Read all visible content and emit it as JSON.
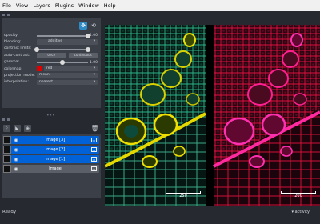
{
  "menu": [
    "File",
    "View",
    "Layers",
    "Plugins",
    "Window",
    "Help"
  ],
  "controls": {
    "rows": [
      {
        "label": "opacity:",
        "kind": "slider",
        "value": "1.00",
        "level": 1.0
      },
      {
        "label": "blending:",
        "kind": "combo",
        "value": "additive"
      },
      {
        "label": "contrast limits:",
        "kind": "range",
        "level_lo": 0.0,
        "level_hi": 1.0
      },
      {
        "label": "auto-contrast:",
        "kind": "pair",
        "left": "once",
        "right": "continuous"
      },
      {
        "label": "gamma:",
        "kind": "slider",
        "value": "1.00",
        "level": 0.5
      },
      {
        "label": "colormap:",
        "kind": "color",
        "value": "red",
        "color": "#e00000"
      },
      {
        "label": "projection mode:",
        "kind": "combo",
        "value": "mean"
      },
      {
        "label": "interpolation:",
        "kind": "combo",
        "value": "nearest"
      }
    ]
  },
  "layers": [
    {
      "name": "Image [3]",
      "selected": true
    },
    {
      "name": "Image [2]",
      "selected": true
    },
    {
      "name": "Image [1]",
      "selected": true
    },
    {
      "name": "Image",
      "selected": false
    }
  ],
  "canvas": {
    "scalebar_left": "250",
    "scalebar_right": "200"
  },
  "status": {
    "left": "Ready",
    "right": "▾ activity"
  },
  "colors": {
    "accent": "#2f8bc6",
    "selected_layer": "#0062d6",
    "panel": "#3a3f48",
    "background": "#262930"
  }
}
